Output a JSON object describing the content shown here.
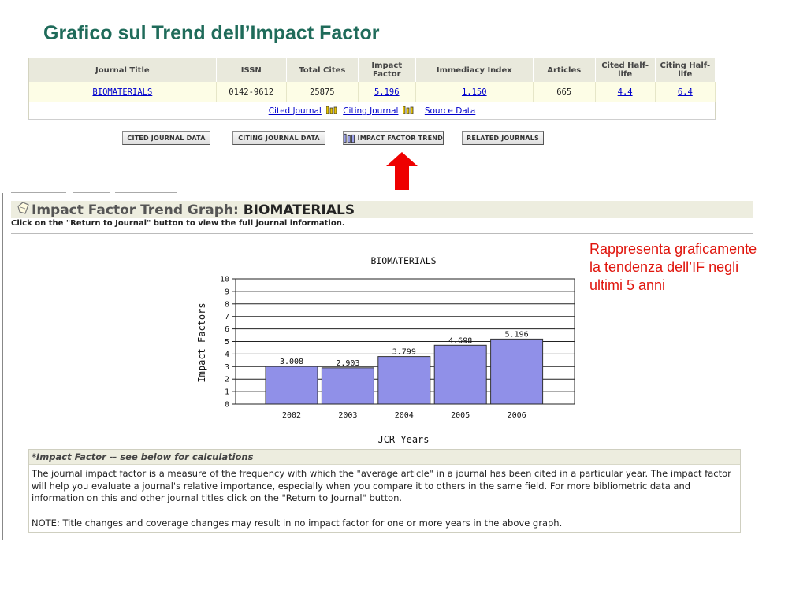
{
  "slide": {
    "title": "Grafico sul Trend dell’Impact Factor",
    "annotation": "Rappresenta graficamente la tendenza dell’IF negli ultimi 5 anni"
  },
  "journal_table": {
    "headers": [
      "Journal Title",
      "ISSN",
      "Total Cites",
      "Impact Factor",
      "Immediacy Index",
      "Articles",
      "Cited Half-life",
      "Citing Half-life"
    ],
    "row": {
      "title": "BIOMATERIALS",
      "issn": "0142-9612",
      "total_cites": "25875",
      "impact_factor": "5.196",
      "immediacy_index": "1.150",
      "articles": "665",
      "cited_half_life": "4.4",
      "citing_half_life": "6.4"
    },
    "links": {
      "cited_journal": "Cited Journal",
      "citing_journal": "Citing Journal",
      "source_data": "Source Data"
    }
  },
  "buttons": {
    "cited_journal_data": "CITED JOURNAL DATA",
    "citing_journal_data": "CITING JOURNAL DATA",
    "impact_factor_trend": "IMPACT FACTOR TREND",
    "related_journals": "RELATED JOURNALS"
  },
  "panel": {
    "title_prefix": "Impact Factor Trend Graph: ",
    "title_journal": "BIOMATERIALS",
    "subtitle": "Click on the \"Return to Journal\" button to view the full journal information."
  },
  "chart_data": {
    "type": "bar",
    "title": "BIOMATERIALS",
    "xlabel": "JCR Years",
    "ylabel": "Impact Factors",
    "categories": [
      "2002",
      "2003",
      "2004",
      "2005",
      "2006"
    ],
    "values": [
      3.008,
      2.903,
      3.799,
      4.698,
      5.196
    ],
    "value_labels": [
      "3.008",
      "2.903",
      "3.799",
      "4.698",
      "5.196"
    ],
    "yticks": [
      "0",
      "1",
      "2",
      "3",
      "4",
      "5",
      "6",
      "7",
      "8",
      "9",
      "10"
    ],
    "ylim": [
      0,
      10
    ],
    "grid": true,
    "bar_color": "#9090e8"
  },
  "info": {
    "heading": "*Impact Factor -- see below for calculations",
    "paragraph": "The journal impact factor is a measure of the frequency with which the \"average article\" in a journal has been cited in a particular year. The impact factor will help you evaluate a journal's relative importance, especially when you compare it to others in the same field. For more bibliometric data and information on this and other journal titles click on the \"Return to Journal\" button.",
    "note": "NOTE: Title changes and coverage changes may result in no impact factor for one or more years in the above graph."
  },
  "colors": {
    "title_green": "#1f6b5a",
    "annotation_red": "#e0140c",
    "link_blue": "#0000cc",
    "header_beige": "#e9e9dc"
  }
}
